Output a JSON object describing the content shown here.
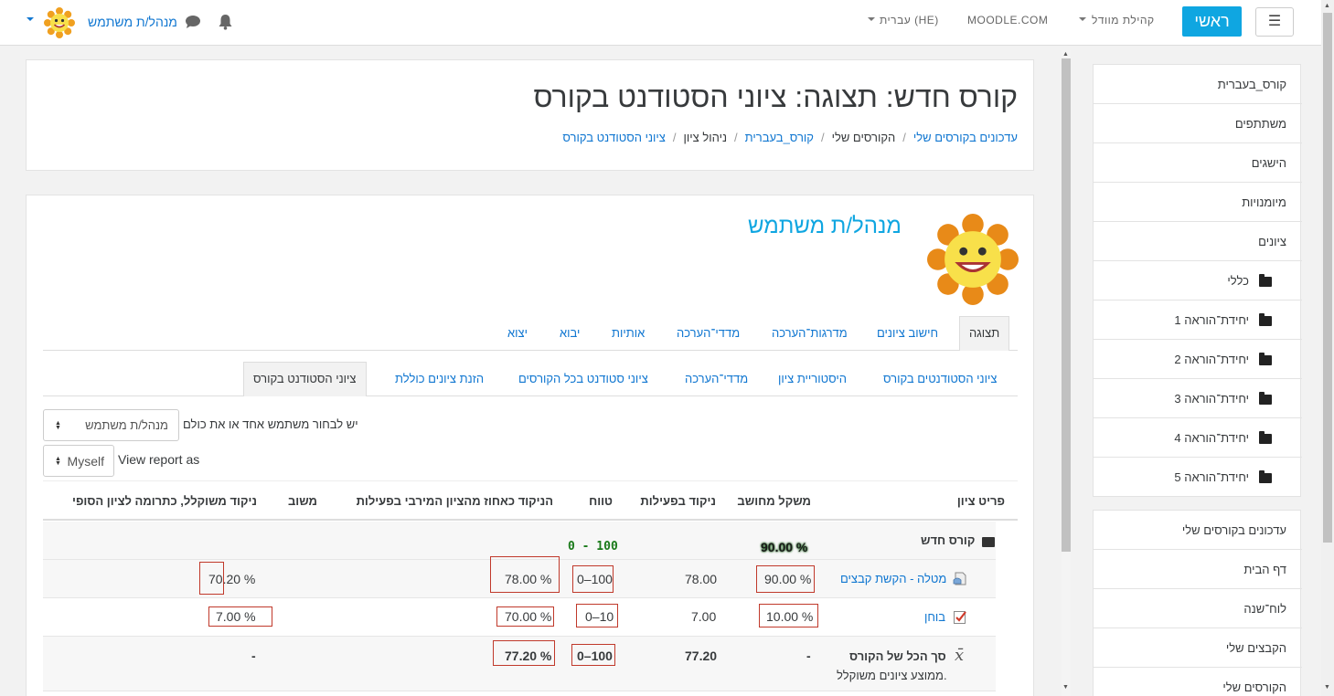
{
  "navbar": {
    "home_label": "ראשי",
    "menu_icon": "☰",
    "community_label": "קהילת מוודל",
    "moodle_label": "MOODLE.COM",
    "language_label": "עברית (HE)",
    "user_name": "מנהל/ת משתמש"
  },
  "header": {
    "title": "קורס חדש: תצוגה: ציוני הסטודנט בקורס",
    "breadcrumb": [
      "עדכונים בקורסים שלי",
      "הקורסים שלי",
      "קורס_בעברית",
      "ניהול ציון",
      "ציוני הסטודנט בקורס"
    ]
  },
  "main": {
    "user_name": "מנהל/ת משתמש",
    "tabs": [
      "תצוגה",
      "חישוב ציונים",
      "מדרגות־הערכה",
      "מדדי־הערכה",
      "אותיות",
      "יבוא",
      "יצוא"
    ],
    "subtabs": [
      "ציוני הסטודנטים בקורס",
      "היסטוריית ציון",
      "מדדי־הערכה",
      "ציוני סטודנט בכל הקורסים",
      "הזנת ציונים כוללת",
      "ציוני הסטודנט בקורס"
    ],
    "select_user_label": "יש לבחור משתמש אחד או את כולם",
    "select_user_value": "מנהל/ת משתמש",
    "view_as_label": "View report as",
    "view_as_value": "Myself"
  },
  "table": {
    "headers": [
      "פריט ציון",
      "משקל מחושב",
      "ניקוד בפעילות",
      "טווח",
      "הניקוד כאחוז מהציון המירבי בפעילות",
      "משוב",
      "ניקוד משוקלל, כתרומה לציון הסופי"
    ],
    "category": {
      "name": "קורס חדש",
      "weight": "90.00 %",
      "range": "0 - 100"
    },
    "rows": [
      {
        "name": "מטלה - הקשת קבצים",
        "weight": "90.00 %",
        "grade": "78.00",
        "range": "0–100",
        "percent": "78.00 %",
        "contribution": "70.20 %"
      },
      {
        "name": "בוחן",
        "weight": "10.00 %",
        "grade": "7.00",
        "range": "0–10",
        "percent": "70.00 %",
        "contribution": "7.00 %"
      }
    ],
    "total": {
      "name": "סך הכל של הקורס",
      "sub": "ממוצע ציונים משוקלל.",
      "weight": "-",
      "grade": "77.20",
      "range": "0–100",
      "percent": "77.20 %",
      "contribution": "-"
    }
  },
  "sidebar": {
    "course_items": [
      "קורס_בעברית",
      "משתתפים",
      "הישגים",
      "מיומנויות",
      "ציונים",
      "כללי",
      "יחידת־הוראה 1",
      "יחידת־הוראה 2",
      "יחידת־הוראה 3",
      "יחידת־הוראה 4",
      "יחידת־הוראה 5"
    ],
    "nav_items": [
      "עדכונים בקורסים שלי",
      "דף הבית",
      "לוח־שנה",
      "הקבצים שלי",
      "הקורסים שלי"
    ]
  },
  "colors": {
    "accent": "#0fa6e1",
    "link": "#1177d1",
    "range_green": "#1a7a1a",
    "highlight_box": "#c0392b"
  }
}
